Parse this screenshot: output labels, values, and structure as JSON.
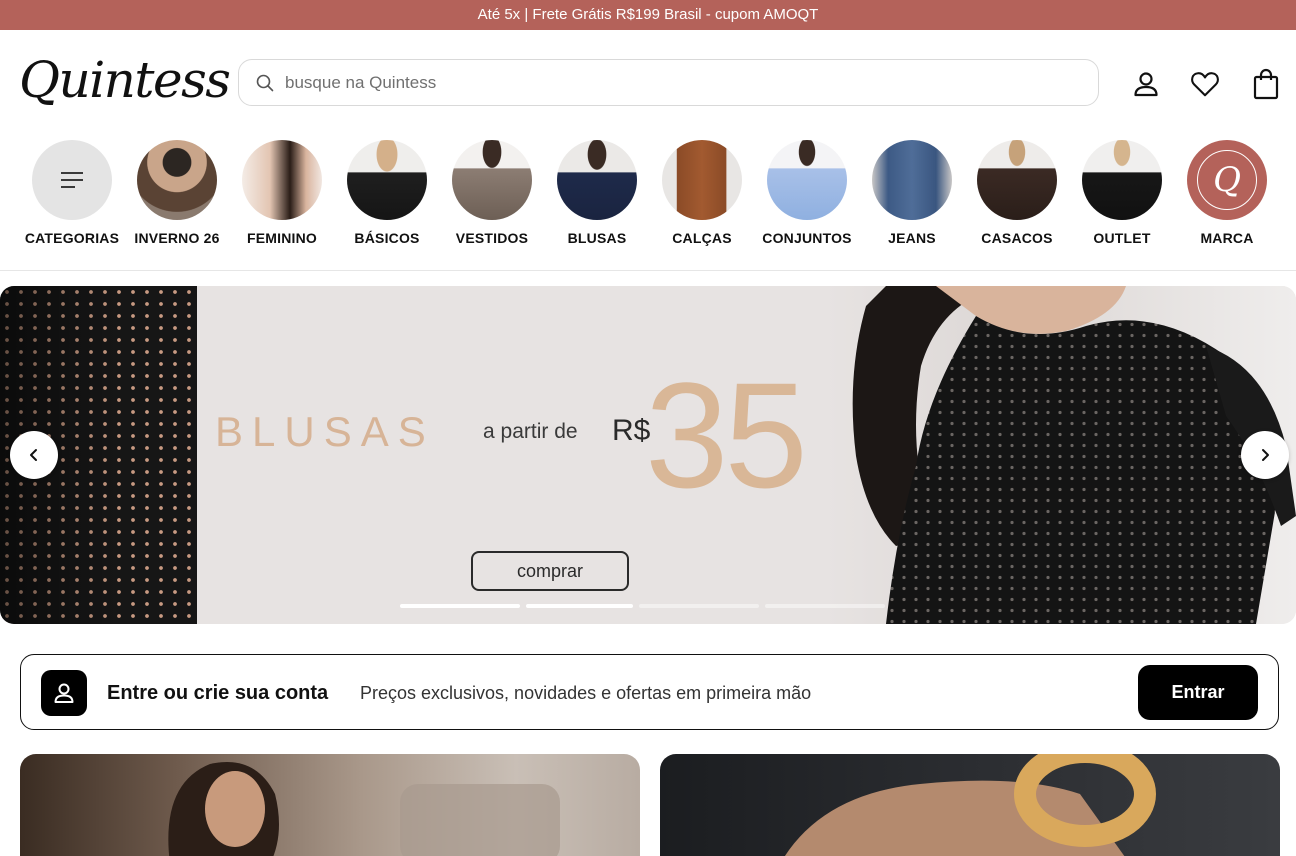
{
  "topbar": {
    "text": "Até 5x | Frete Grátis R$199 Brasil - cupom AMOQT"
  },
  "header": {
    "logo": "Quintess",
    "search_placeholder": "busque na Quintess",
    "icons": [
      "user-icon",
      "heart-icon",
      "bag-icon"
    ]
  },
  "categories": [
    {
      "label": "CATEGORIAS",
      "icon": "menu-icon"
    },
    {
      "label": "INVERNO 26"
    },
    {
      "label": "FEMININO"
    },
    {
      "label": "BÁSICOS"
    },
    {
      "label": "VESTIDOS"
    },
    {
      "label": "BLUSAS"
    },
    {
      "label": "CALÇAS"
    },
    {
      "label": "CONJUNTOS"
    },
    {
      "label": "JEANS"
    },
    {
      "label": "CASACOS"
    },
    {
      "label": "OUTLET"
    },
    {
      "label": "MARCA",
      "brand_mark": "Q"
    }
  ],
  "banner": {
    "title": "BLUSAS",
    "from_text": "a partir de",
    "currency": "R$",
    "price": "35",
    "button": "comprar",
    "slides_count": 4,
    "active_slide": 2,
    "accent_color": "#d9b797"
  },
  "login": {
    "title": "Entre ou crie sua conta",
    "subtitle": "Preços exclusivos, novidades e ofertas em primeira mão",
    "button": "Entrar"
  },
  "colors": {
    "topbar_bg": "#b4625a",
    "brand_circle": "#b4625a",
    "button_bg": "#000000"
  }
}
